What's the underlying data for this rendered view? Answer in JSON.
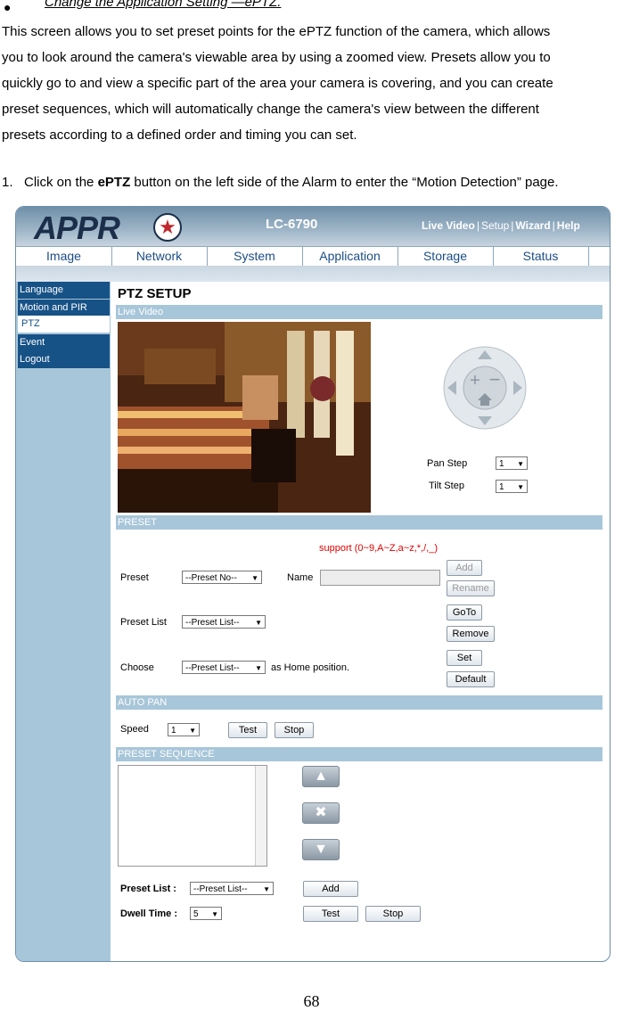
{
  "doc": {
    "bullet": "●",
    "heading": "Change the Application Setting —ePTZ.",
    "paragraph_lines": [
      "This screen allows you to set preset points for the ePTZ function of the camera, which allows",
      "you to look around the camera's viewable area by  using a zoomed view. Presets allow you to",
      "quickly go to and view a specific part of the area your camera is covering, and you can create",
      "preset  sequences, which will automatically change the camera's view between the different",
      "presets according to a defined order and timing you can set."
    ],
    "step_prefix": "1.   Click on the ",
    "step_bold": "ePTZ",
    "step_suffix": " button on the left side of the Alarm to enter the “Motion Detection” page.",
    "page_number": "68"
  },
  "screenshot": {
    "logo_text": "APPR",
    "logo_star": "★",
    "model": "LC-6790",
    "top_links": [
      "Live Video",
      "Setup",
      "Wizard",
      "Help"
    ],
    "top_sep": "|",
    "menu": [
      "Image",
      "Network",
      "System",
      "Application",
      "Storage",
      "Status"
    ],
    "sidebar": [
      {
        "label": "Language",
        "active": false
      },
      {
        "label": "Motion and PIR",
        "active": false
      },
      {
        "label": "PTZ",
        "active": true
      },
      {
        "label": "Event",
        "active": false
      },
      {
        "label": "Logout",
        "active": false
      }
    ],
    "page_title": "PTZ SETUP",
    "sections": {
      "live_video": "Live Video",
      "preset": "PRESET",
      "auto_pan": "AUTO PAN",
      "preset_sequence": "PRESET SEQUENCE"
    },
    "pan_step_label": "Pan Step",
    "pan_step_value": "1",
    "tilt_step_label": "Tilt Step",
    "tilt_step_value": "1",
    "dropdown_arrow": "▼",
    "support_text": "support (0~9,A~Z,a~z,*,/,_)",
    "preset_label": "Preset",
    "preset_value": "--Preset No--",
    "name_label": "Name",
    "preset_list_label": "Preset List",
    "preset_list_value": "--Preset List--",
    "choose_label": "Choose",
    "choose_value": "--Preset List--",
    "home_text": "as Home position.",
    "btn_add": "Add",
    "btn_rename": "Rename",
    "btn_goto": "GoTo",
    "btn_remove": "Remove",
    "btn_set": "Set",
    "btn_default": "Default",
    "speed_label": "Speed",
    "speed_value": "1",
    "btn_test": "Test",
    "btn_stop": "Stop",
    "seq_preset_list_label": "Preset List :",
    "seq_preset_list_value": "--Preset List--",
    "dwell_label": "Dwell Time :",
    "dwell_value": "5",
    "seq_btn_add": "Add",
    "seq_btn_test": "Test",
    "seq_btn_stop": "Stop",
    "arrow_up": "▲",
    "arrow_x": "✖",
    "arrow_down": "▼"
  }
}
